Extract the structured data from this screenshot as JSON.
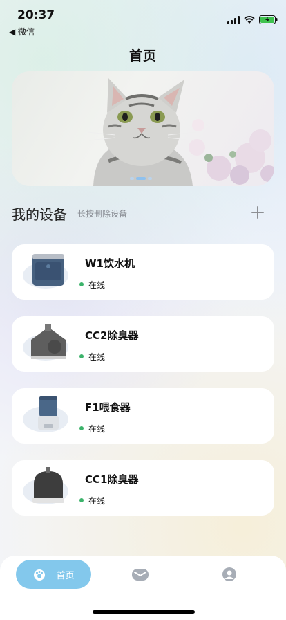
{
  "status_bar": {
    "time": "20:37",
    "back_label": "◀ 微信"
  },
  "page": {
    "title": "首页"
  },
  "banner": {
    "slides": 3,
    "active_slide": 2
  },
  "devices_section": {
    "title": "我的设备",
    "hint": "长按删除设备"
  },
  "devices": [
    {
      "name": "W1饮水机",
      "status": "在线"
    },
    {
      "name": "CC2除臭器",
      "status": "在线"
    },
    {
      "name": "F1喂食器",
      "status": "在线"
    },
    {
      "name": "CC1除臭器",
      "status": "在线"
    }
  ],
  "tab_bar": {
    "home_label": "首页"
  },
  "colors": {
    "accent": "#83c8ec",
    "online": "#3cb36b"
  }
}
